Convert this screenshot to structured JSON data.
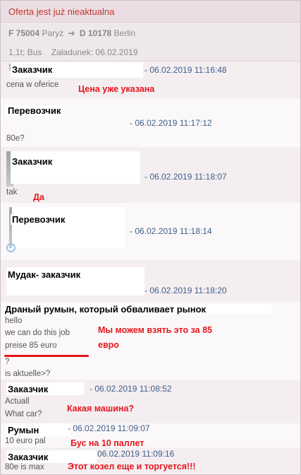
{
  "header": {
    "status": "Oferta jest już nieaktualna",
    "from_code": "F 75004",
    "from_city": "Paryż",
    "to_code": "D 10178",
    "to_city": "Berlin",
    "details": "1,1t; Bus",
    "loading": "Załadunek: 06.02.2019"
  },
  "messages": [
    {
      "author": "Заказчик",
      "time": "- 06.02.2019 11:16:48",
      "text": "cena w oferice",
      "note": "Цена уже указана"
    },
    {
      "author": "Перевозчик",
      "time": "- 06.02.2019 11:17:12",
      "text": "80e?"
    },
    {
      "author": "Заказчик",
      "time": "- 06.02.2019 11:18:07",
      "text": "tak",
      "note": "Да"
    },
    {
      "author": "Перевозчик",
      "time": "- 06.02.2019 11:18:14"
    },
    {
      "author": "Мудак- заказчик",
      "time": "- 06.02.2019 11:18:20"
    },
    {
      "author": "Драный румын, который обваливает рынок",
      "lines": [
        "hello",
        "we can do this job",
        "preise 85 euro",
        "?",
        "is aktuelle>?"
      ],
      "note_lines": [
        "Мы можем взять это за 85",
        "евро"
      ]
    },
    {
      "author": "Заказчик",
      "time": "- 06.02.2019 11:08:52",
      "lines": [
        "Actuall",
        "What car?"
      ],
      "note": "Какая машина?"
    },
    {
      "author": "Румын",
      "time": "- 06.02.2019 11:09:07",
      "text": "10 euro pal",
      "note": "Бус на 10 паллет"
    },
    {
      "author": "Заказчик",
      "time": "06.02.2019 11:09:16",
      "text": "80e is max",
      "note": "Этот козел еще и торгуется!!!"
    }
  ]
}
